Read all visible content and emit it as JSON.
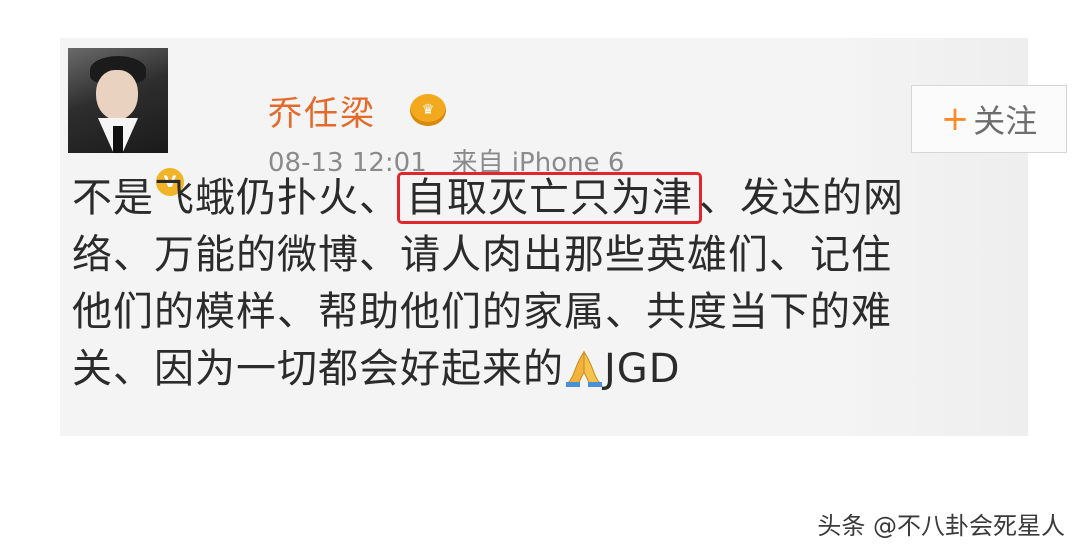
{
  "post": {
    "username": "乔任梁",
    "timestamp": "08-13 12:01",
    "source": "来自 iPhone 6",
    "follow_button": {
      "plus": "+",
      "label": "关注"
    },
    "lines": {
      "l1_before": "不是飞蛾仍扑火、",
      "l1_highlight": "自取灭亡只为津",
      "l1_after": "、发达的网",
      "l2": "络、万能的微博、请人肉出那些英雄们、记住",
      "l3": "他们的模样、帮助他们的家属、共度当下的难",
      "l4_before": "关、因为一切都会好起来的",
      "l4_after": "JGD"
    },
    "emoji": "folded-hands-icon",
    "verified_badge": "V"
  },
  "watermark": "头条 @不八卦会死星人",
  "colors": {
    "username": "#e46a2a",
    "highlight_border": "#e0262c",
    "vip": "#f2a91e",
    "follow_plus": "#ff8a2b"
  }
}
